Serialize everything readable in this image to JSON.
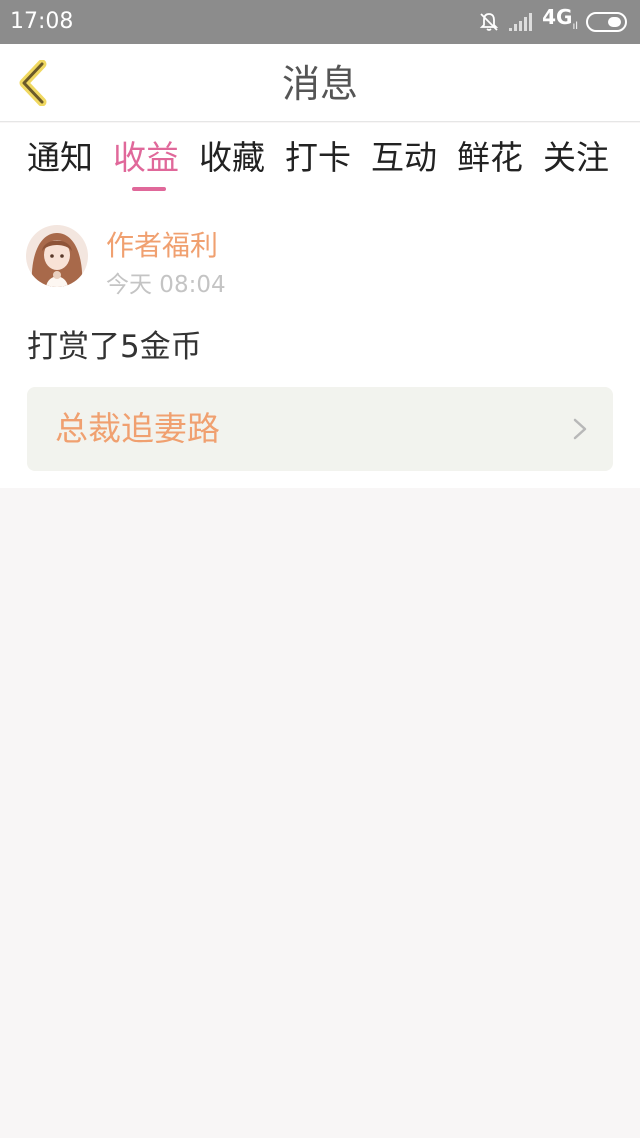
{
  "status_bar": {
    "time": "17:08",
    "network": "4G",
    "network_sub": "ıl",
    "icons": [
      "bell-off-icon",
      "signal-icon",
      "battery-icon"
    ]
  },
  "header": {
    "title": "消息",
    "back_icon": "chevron-left-icon"
  },
  "tabs": [
    {
      "label": "通知",
      "active": false
    },
    {
      "label": "收益",
      "active": true
    },
    {
      "label": "收藏",
      "active": false
    },
    {
      "label": "打卡",
      "active": false
    },
    {
      "label": "互动",
      "active": false
    },
    {
      "label": "鲜花",
      "active": false
    },
    {
      "label": "关注",
      "active": false
    }
  ],
  "notification": {
    "sender": "作者福利",
    "time": "今天 08:04",
    "message": "打赏了5金币",
    "book_title": "总裁追妻路",
    "avatar_icon": "avatar",
    "chevron_icon": "chevron-right-icon"
  },
  "colors": {
    "accent": "#e0689a",
    "orange": "#f0a070",
    "status_bar": "#8c8c8c",
    "back_icon": "#f0d860",
    "book_card_bg": "#f2f3ee",
    "page_bg": "#f8f6f6"
  }
}
